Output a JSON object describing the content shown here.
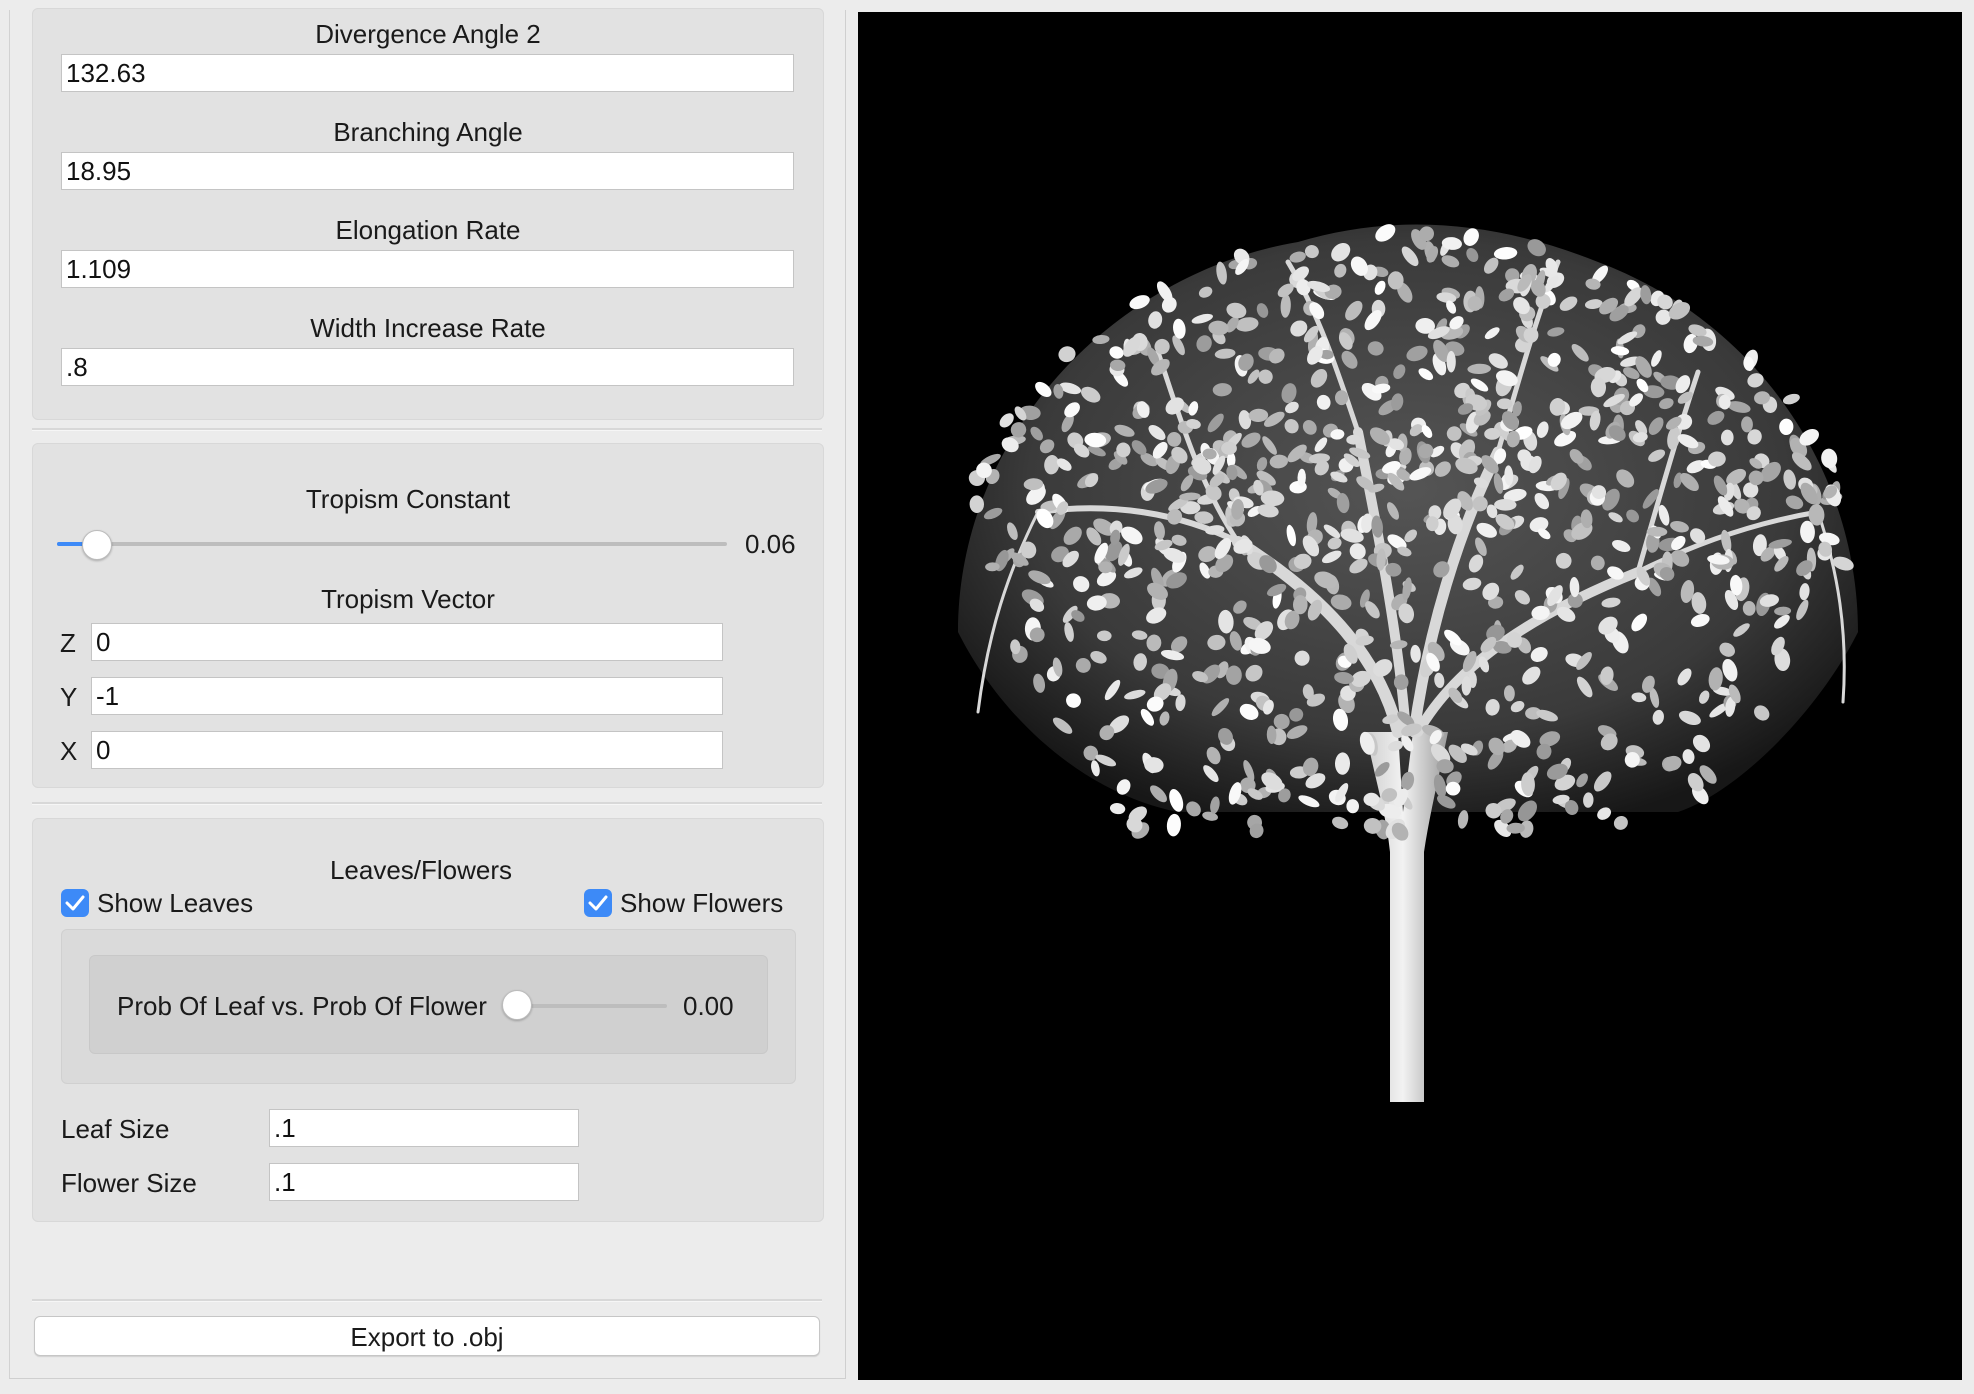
{
  "parameters": {
    "divergence_angle_2": {
      "label": "Divergence Angle 2",
      "value": "132.63"
    },
    "branching_angle": {
      "label": "Branching Angle",
      "value": "18.95"
    },
    "elongation_rate": {
      "label": "Elongation Rate",
      "value": "1.109"
    },
    "width_increase_rate": {
      "label": "Width Increase Rate",
      "value": ".8"
    }
  },
  "tropism": {
    "constant_label": "Tropism Constant",
    "constant_value": "0.06",
    "constant_fraction": 0.06,
    "vector_label": "Tropism Vector",
    "z_label": "Z",
    "z_value": "0",
    "y_label": "Y",
    "y_value": "-1",
    "x_label": "X",
    "x_value": "0"
  },
  "leaves_flowers": {
    "title": "Leaves/Flowers",
    "show_leaves_label": "Show Leaves",
    "show_leaves_checked": true,
    "show_flowers_label": "Show Flowers",
    "show_flowers_checked": true,
    "prob_label": "Prob Of Leaf vs. Prob Of Flower",
    "prob_value": "0.00",
    "prob_fraction": 0.0,
    "leaf_size_label": "Leaf Size",
    "leaf_size_value": ".1",
    "flower_size_label": "Flower Size",
    "flower_size_value": ".1"
  },
  "export_button_label": "Export to .obj",
  "colors": {
    "accent": "#3d8af7",
    "viewport_background": "#000000",
    "panel_background": "#ececec"
  }
}
